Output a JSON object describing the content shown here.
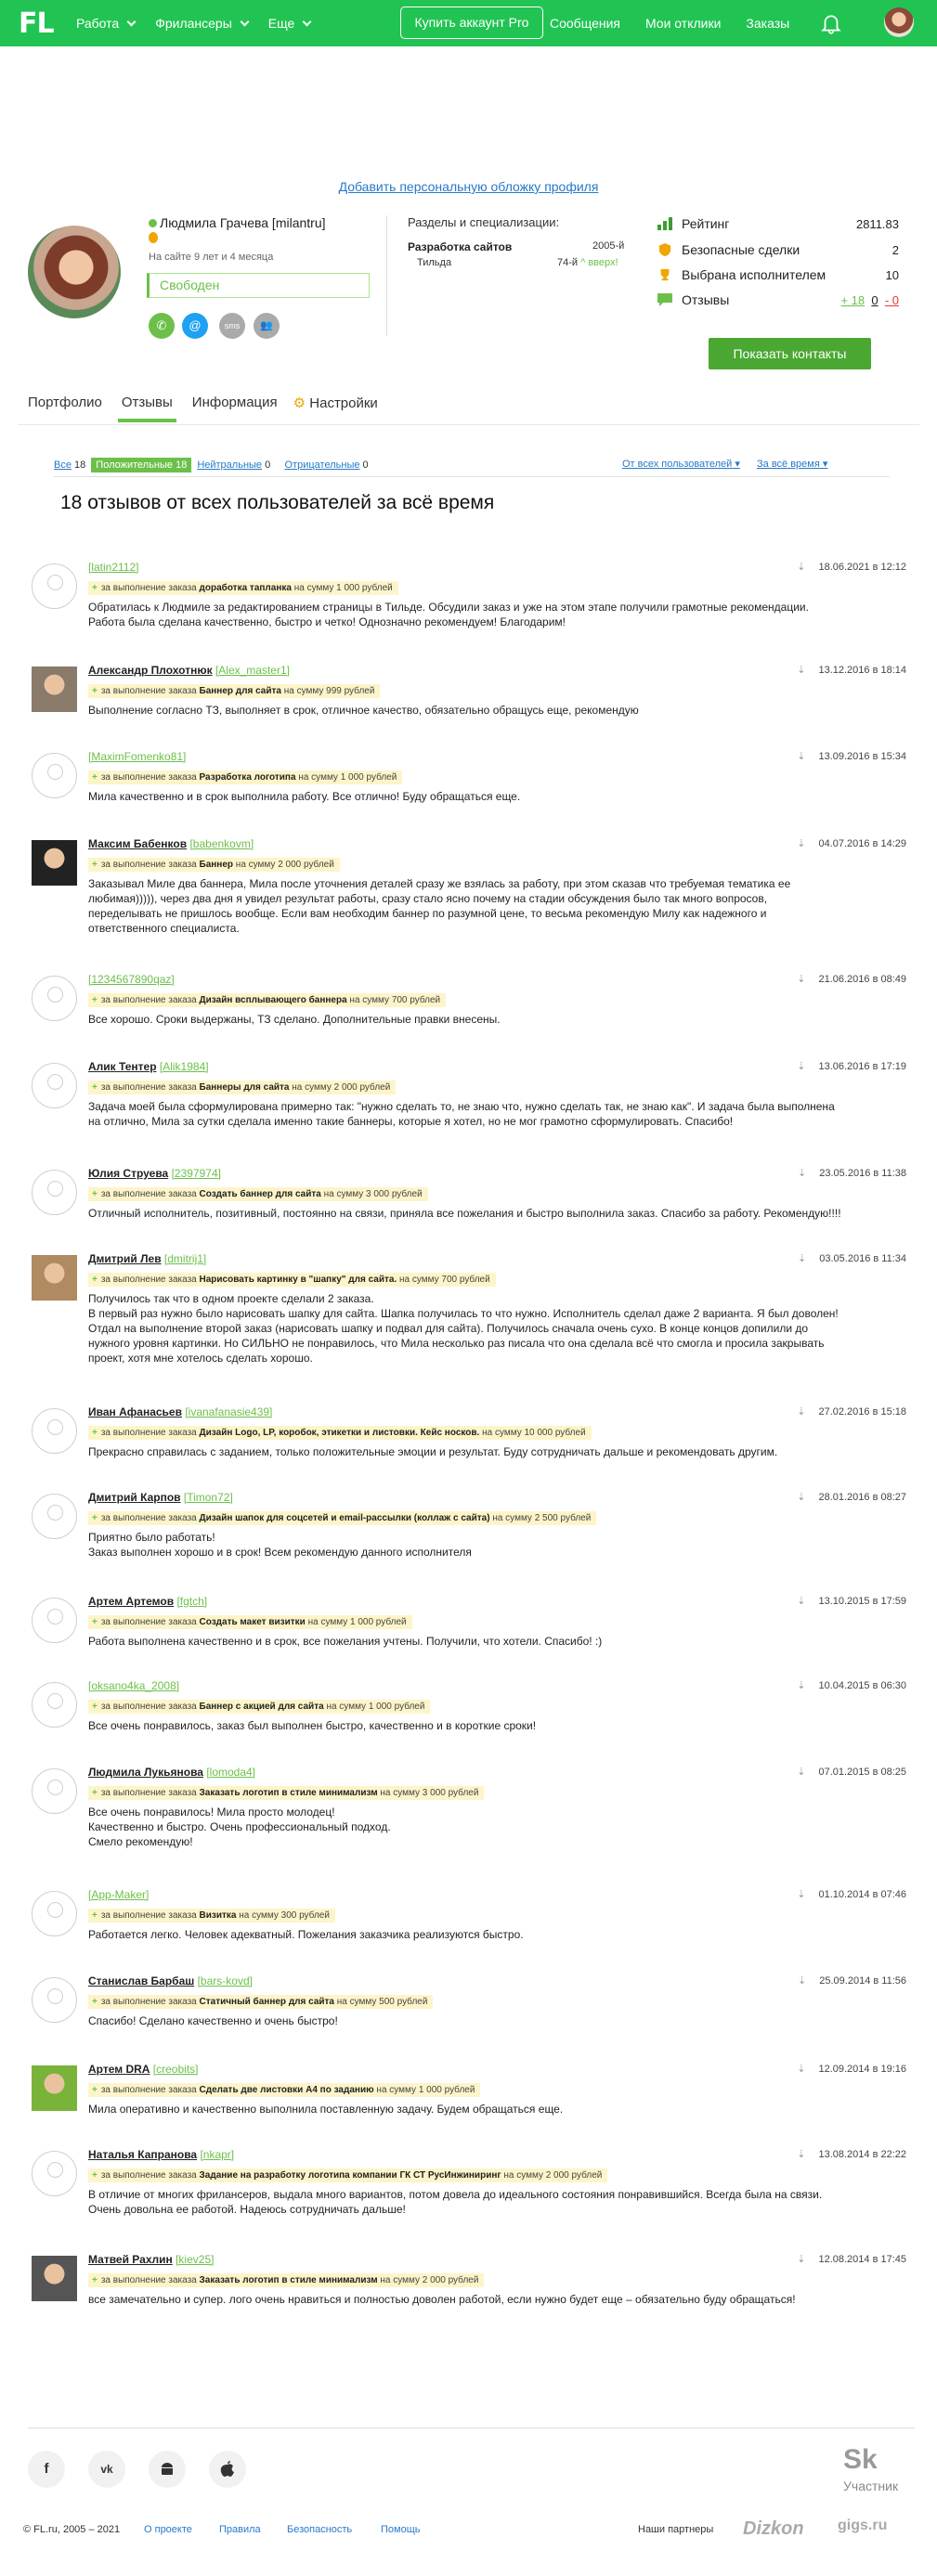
{
  "header": {
    "logo": "FL",
    "nav": [
      "Работа",
      "Фрилансеры",
      "Еще"
    ],
    "pro_button": "Купить аккаунт Pro",
    "right_nav": [
      "Сообщения",
      "Мои отклики",
      "Заказы"
    ]
  },
  "cover_link": "Добавить персональную обложку профиля",
  "profile": {
    "name": "Людмила Грачева [milantru]",
    "on_site": "На сайте 9 лет и 4 месяца",
    "status": "Свободен",
    "contact_icons": [
      "phone-icon",
      "email-icon",
      "sms-icon",
      "users-icon"
    ],
    "contact_labels": [
      "✆",
      "@",
      "sms",
      "👥"
    ],
    "spec_header": "Разделы и специализации:",
    "specs": [
      {
        "name": "Разработка сайтов",
        "rank": "2005-й"
      },
      {
        "name": "Тильда",
        "rank": "74-й",
        "trend": "^ вверх!"
      }
    ],
    "stats": [
      {
        "label": "Рейтинг",
        "value": "2811.83",
        "color": "#3c9e2f"
      },
      {
        "label": "Безопасные сделки",
        "value": "2",
        "color": "#f0a500"
      },
      {
        "label": "Выбрана исполнителем",
        "value": "10",
        "color": "#f0a500"
      },
      {
        "label": "Отзывы",
        "pos": "+ 18",
        "neu": "0",
        "neg": "- 0",
        "color": "#6cc04a"
      }
    ],
    "contacts_button": "Показать контакты"
  },
  "tabs": [
    "Портфолио",
    "Отзывы",
    "Информация",
    "Настройки"
  ],
  "filters": {
    "all": "Все",
    "all_count": "18",
    "positive": "Положительные 18",
    "neutral": "Нейтральные",
    "neutral_count": "0",
    "negative": "Отрицательные",
    "negative_count": "0",
    "from": "От всех пользователей",
    "period": "За всё время"
  },
  "title": "18 отзывов от всех пользователей за всё время",
  "reviews": [
    {
      "name": "",
      "login": "[latin2112]",
      "date": "18.06.2021 в 12:12",
      "project": "доработка тапланка",
      "sum": "на сумму 1 000 рублей",
      "text": "Обратилась к Людмиле за редактированием страницы в Тильде. Обсудили заказ и уже на этом этапе получили грамотные рекомендации.\nРабота была сделана качественно, быстро и четко! Однозначно рекомендуем! Благодарим!"
    },
    {
      "name": "Александр Плохотнюк",
      "login": "[Alex_master1]",
      "date": "13.12.2016 в 18:14",
      "project": "Баннер для сайта",
      "sum": "на сумму 999 рублей",
      "text": "Выполнение согласно ТЗ, выполняет в срок, отличное качество, обязательно обращусь еще, рекомендую"
    },
    {
      "name": "",
      "login": "[MaximFomenko81]",
      "date": "13.09.2016 в 15:34",
      "project": "Разработка логотипа",
      "sum": "на сумму 1 000 рублей",
      "text": "Мила качественно и в срок  выполнила работу. Все отлично! Буду обращаться еще."
    },
    {
      "name": "Максим Бабенков",
      "login": "[babenkovm]",
      "date": "04.07.2016 в 14:29",
      "project": "Баннер",
      "sum": "на сумму 2 000 рублей",
      "text": "Заказывал Миле два баннера, Мила после уточнения деталей сразу же взялась за работу, при этом сказав что требуемая тематика ее\nлюбимая))))), через два дня я увидел результат работы, сразу стало ясно почему на стадии обсуждения было так много вопросов,\nпеределывать не пришлось вообще. Если вам необходим баннер по разумной цене, то весьма рекомендую Милу как надежного и\nответственного специалиста."
    },
    {
      "name": "",
      "login": "[1234567890qaz]",
      "date": "21.06.2016 в 08:49",
      "project": "Дизайн всплывающего баннера",
      "sum": "на сумму 700 рублей",
      "text": "Все хорошо. Сроки выдержаны, ТЗ сделано. Дополнительные правки внесены."
    },
    {
      "name": "Алик Тентер",
      "login": "[Alik1984]",
      "date": "13.06.2016 в 17:19",
      "project": "Баннеры для сайта",
      "sum": "на сумму 2 000 рублей",
      "text": "Задача моей была сформулирована примерно так: \"нужно сделать то, не знаю что, нужно сделать так, не знаю как\". И задача была выполнена\nна отлично, Мила за сутки сделала именно такие баннеры, которые я хотел, но не мог грамотно сформулировать. Спасибо!"
    },
    {
      "name": "Юлия Струева",
      "login": "[2397974]",
      "date": "23.05.2016 в 11:38",
      "project": "Создать баннер для сайта",
      "sum": "на сумму 3 000 рублей",
      "text": "Отличный исполнитель, позитивный, постоянно на связи, приняла все пожелания и быстро выполнила заказ. Спасибо за работу. Рекомендую!!!!"
    },
    {
      "name": "Дмитрий Лев",
      "login": "[dmitrij1]",
      "date": "03.05.2016 в 11:34",
      "project": "Нарисовать картинку в \"шапку\" для сайта.",
      "sum": "на сумму 700 рублей",
      "text": "Получилось так что в одном проекте сделали 2 заказа.\nВ первый раз нужно было нарисовать шапку для сайта. Шапка получилась то что нужно. Исполнитель сделал даже 2 варианта. Я был доволен!\nОтдал на выполнение второй заказ (нарисовать шапку и подвал для сайта). Получилось сначала очень сухо. В конце концов допилили до\nнужного уровня картинки. Но СИЛЬНО не понравилось, что Мила несколько раз писала что она сделала всё что смогла и просила закрывать\nпроект, хотя мне хотелось сделать хорошо."
    },
    {
      "name": "Иван Афанасьев",
      "login": "[ivanafanasie439]",
      "date": "27.02.2016 в 15:18",
      "project": "Дизайн Logo, LP, коробок, этикетки и листовки. Кейс носков.",
      "sum": "на сумму 10 000 рублей",
      "text": "Прекрасно справилась с заданием, только положительные эмоции и результат. Буду сотрудничать дальше и рекомендовать другим."
    },
    {
      "name": "Дмитрий Карпов",
      "login": "[Timon72]",
      "date": "28.01.2016 в 08:27",
      "project": "Дизайн шапок для соцсетей и email-рассылки (коллаж с сайта)",
      "sum": "на сумму 2 500 рублей",
      "text": "Приятно было работать!\nЗаказ выполнен хорошо и в срок! Всем рекомендую данного исполнителя"
    },
    {
      "name": "Артем Артемов",
      "login": "[fgtch]",
      "date": "13.10.2015 в 17:59",
      "project": "Создать макет визитки",
      "sum": "на сумму 1 000 рублей",
      "text": "Работа выполнена качественно и в срок, все пожелания учтены. Получили, что хотели. Спасибо! :)"
    },
    {
      "name": "",
      "login": "[oksano4ka_2008]",
      "date": "10.04.2015 в 06:30",
      "project": "Баннер с акцией для сайта",
      "sum": "на сумму 1 000 рублей",
      "text": "Все очень понравилось, заказ был выполнен быстро, качественно и в короткие сроки!"
    },
    {
      "name": "Людмила Лукьянова",
      "login": "[lomoda4]",
      "date": "07.01.2015 в 08:25",
      "project": "Заказать логотип в стиле минимализм",
      "sum": "на сумму 3 000 рублей",
      "text": "Все очень понравилось! Мила просто молодец!\nКачественно и быстро. Очень профессиональный подход.\nСмело рекомендую!"
    },
    {
      "name": "",
      "login": "[App-Maker]",
      "date": "01.10.2014 в 07:46",
      "project": "Визитка",
      "sum": "на сумму 300 рублей",
      "text": "Работается легко. Человек адекватный. Пожелания заказчика реализуются быстро."
    },
    {
      "name": "Станислав Барбаш",
      "login": "[bars-kovd]",
      "date": "25.09.2014 в 11:56",
      "project": "Статичный баннер для сайта",
      "sum": "на сумму 500 рублей",
      "text": "Спасибо! Сделано качественно и очень быстро!"
    },
    {
      "name": "Артем DRA",
      "login": "[creobits]",
      "date": "12.09.2014 в 19:16",
      "project": "Сделать две листовки А4 по заданию",
      "sum": "на сумму 1 000 рублей",
      "text": "Мила оперативно и качественно выполнила поставленную задачу. Будем обращаться еще."
    },
    {
      "name": "Наталья Капранова",
      "login": "[nkapr]",
      "date": "13.08.2014 в 22:22",
      "project": "Задание на разработку логотипа компании ГК СТ РусИнжиниринг",
      "sum": "на сумму 2 000 рублей",
      "text": "В отличие от многих фрилансеров, выдала много вариантов, потом довела до идеального состояния понравившийся. Всегда была на связи.\nОчень довольна ее работой. Надеюсь сотрудничать дальше!"
    },
    {
      "name": "Матвей Рахлин",
      "login": "[kiev25]",
      "date": "12.08.2014 в 17:45",
      "project": "Заказать логотип в стиле минимализм",
      "sum": "на сумму 2 000 рублей",
      "text": "все замечательно и супер. лого очень нравиться и полностью доволен работой, если нужно будет еще – обязательно буду обращаться!"
    }
  ],
  "review_prefix": "за выполнение заказа",
  "footer": {
    "social": [
      "f",
      "vk",
      "android",
      ""
    ],
    "social_icons": [
      "facebook-icon",
      "vk-icon",
      "android-icon",
      "apple-icon"
    ],
    "sk": "Sk",
    "sk_participant": "Участник",
    "copyright": "© FL.ru, 2005 – 2021",
    "links": [
      "О проекте",
      "Правила",
      "Безопасность",
      "Помощь"
    ],
    "partners": "Наши партнеры",
    "partner1": "Dizkon",
    "partner2": "gigs.ru"
  }
}
